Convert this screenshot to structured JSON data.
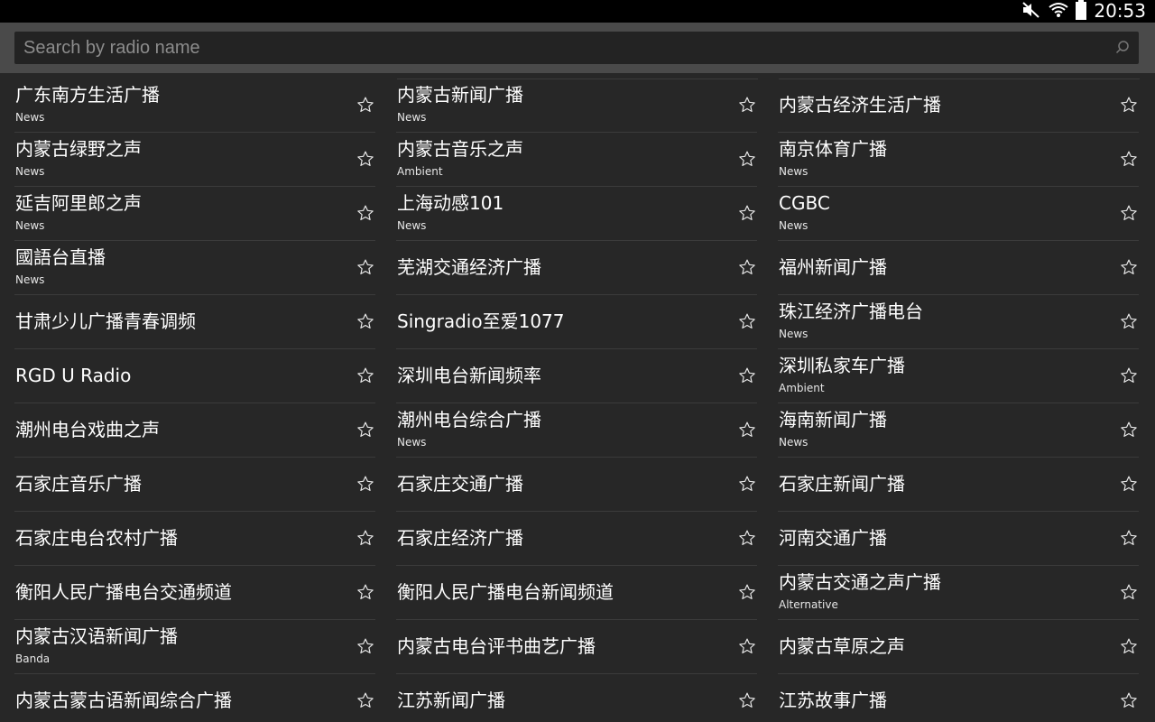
{
  "status_bar": {
    "time": "20:53",
    "icons": [
      "mute-icon",
      "wifi-icon",
      "battery-icon"
    ]
  },
  "search": {
    "placeholder": "Search by radio name",
    "value": ""
  },
  "stations": {
    "col1": [
      {
        "name": "广东南方生活广播",
        "genre": "News"
      },
      {
        "name": "内蒙古绿野之声",
        "genre": "News"
      },
      {
        "name": "延吉阿里郎之声",
        "genre": "News"
      },
      {
        "name": "國語台直播",
        "genre": "News"
      },
      {
        "name": "甘肃少儿广播青春调频",
        "genre": ""
      },
      {
        "name": "RGD U Radio",
        "genre": ""
      },
      {
        "name": "潮州电台戏曲之声",
        "genre": ""
      },
      {
        "name": "石家庄音乐广播",
        "genre": ""
      },
      {
        "name": "石家庄电台农村广播",
        "genre": ""
      },
      {
        "name": "衡阳人民广播电台交通频道",
        "genre": ""
      },
      {
        "name": "内蒙古汉语新闻广播",
        "genre": "Banda"
      },
      {
        "name": "内蒙古蒙古语新闻综合广播",
        "genre": ""
      }
    ],
    "col2": [
      {
        "name": "内蒙古新闻广播",
        "genre": "News"
      },
      {
        "name": "内蒙古音乐之声",
        "genre": "Ambient"
      },
      {
        "name": "上海动感101",
        "genre": "News"
      },
      {
        "name": "芜湖交通经济广播",
        "genre": ""
      },
      {
        "name": "Singradio至爱1077",
        "genre": ""
      },
      {
        "name": "深圳电台新闻频率",
        "genre": ""
      },
      {
        "name": "潮州电台综合广播",
        "genre": "News"
      },
      {
        "name": "石家庄交通广播",
        "genre": ""
      },
      {
        "name": "石家庄经济广播",
        "genre": ""
      },
      {
        "name": "衡阳人民广播电台新闻频道",
        "genre": ""
      },
      {
        "name": "内蒙古电台评书曲艺广播",
        "genre": ""
      },
      {
        "name": "江苏新闻广播",
        "genre": ""
      }
    ],
    "col3": [
      {
        "name": "内蒙古经济生活广播",
        "genre": ""
      },
      {
        "name": "南京体育广播",
        "genre": "News"
      },
      {
        "name": "CGBC",
        "genre": "News"
      },
      {
        "name": "福州新闻广播",
        "genre": ""
      },
      {
        "name": "珠江经济广播电台",
        "genre": "News"
      },
      {
        "name": "深圳私家车广播",
        "genre": "Ambient"
      },
      {
        "name": "海南新闻广播",
        "genre": "News"
      },
      {
        "name": "石家庄新闻广播",
        "genre": ""
      },
      {
        "name": "河南交通广播",
        "genre": ""
      },
      {
        "name": "内蒙古交通之声广播",
        "genre": "Alternative"
      },
      {
        "name": "内蒙古草原之声",
        "genre": ""
      },
      {
        "name": "江苏故事广播",
        "genre": ""
      }
    ]
  },
  "colors": {
    "background": "#272727",
    "search_bar": "#4a4a4a",
    "search_field": "#232323",
    "divider": "#3b3b3b"
  }
}
